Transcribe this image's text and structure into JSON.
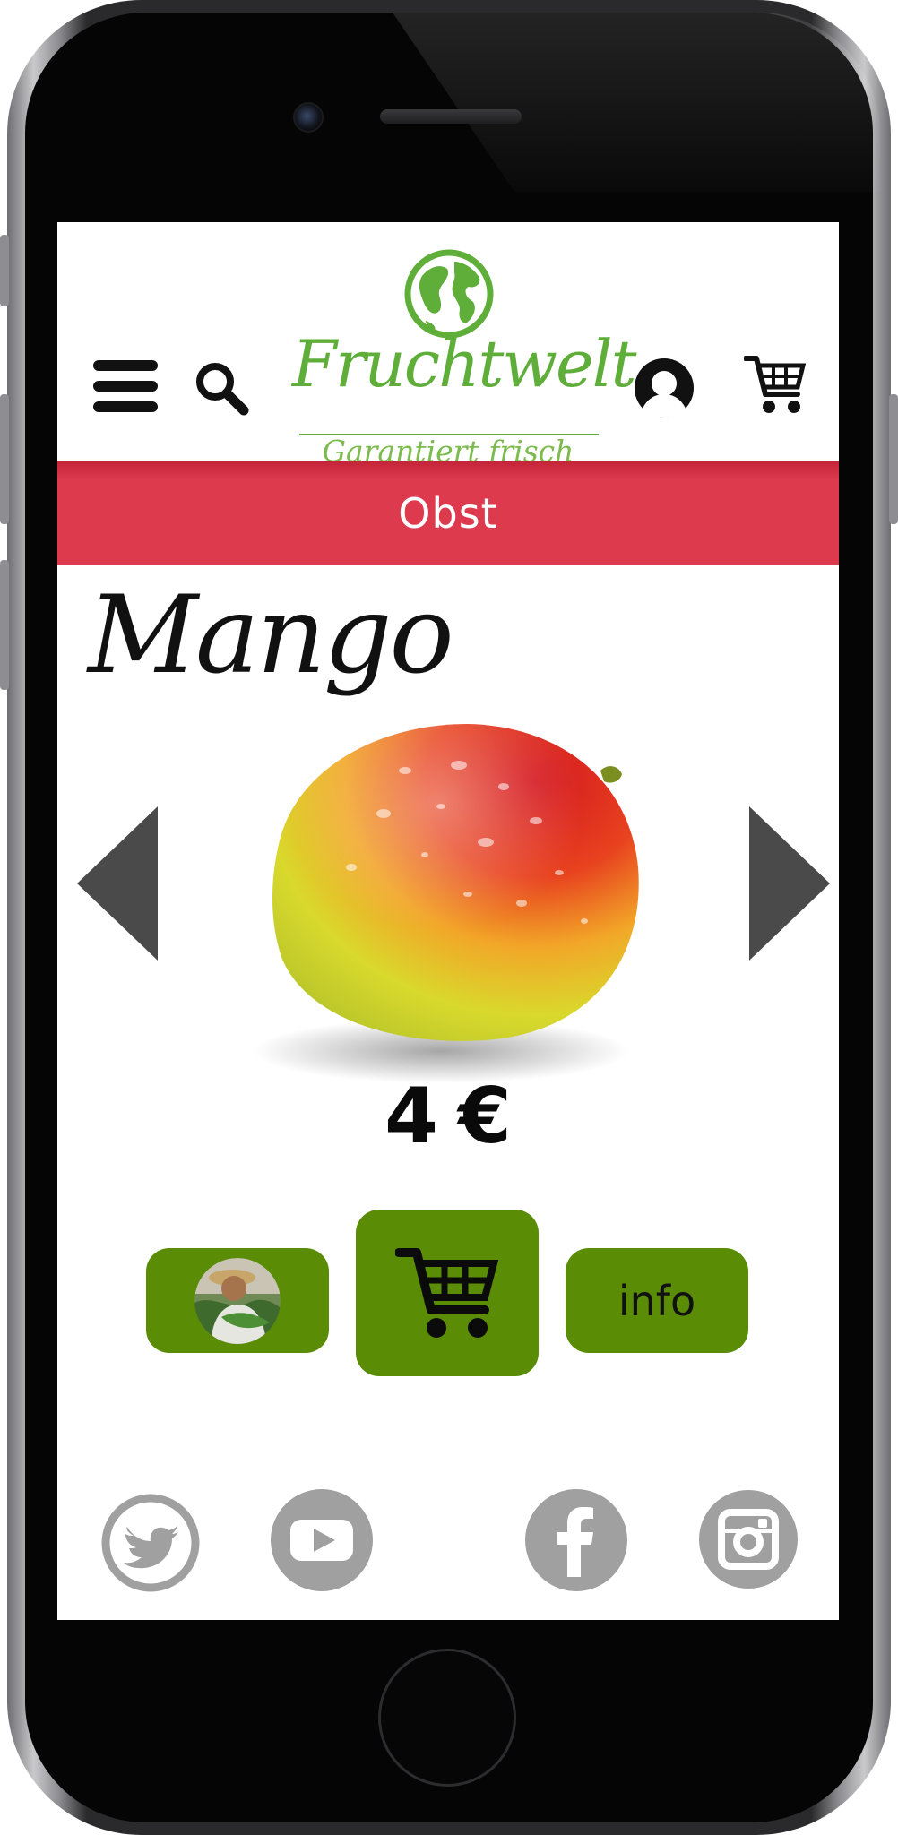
{
  "header": {
    "brand_name": "Fruchtwelt",
    "brand_tagline": "Garantiert frisch",
    "icons": [
      "menu-icon",
      "search-icon",
      "account-icon",
      "cart-icon"
    ]
  },
  "category": {
    "label": "Obst",
    "color": "#dd3a4e"
  },
  "product": {
    "title": "Mango",
    "price_value": "4",
    "price_currency": "€"
  },
  "actions": {
    "info_label": "info",
    "button_color": "#5a8c05"
  },
  "social": [
    "twitter-icon",
    "youtube-icon",
    "facebook-icon",
    "instagram-icon"
  ],
  "colors": {
    "brand_green": "#5fae3a",
    "icon_gray": "#a0a0a0",
    "arrow_gray": "#4a4a4a"
  }
}
